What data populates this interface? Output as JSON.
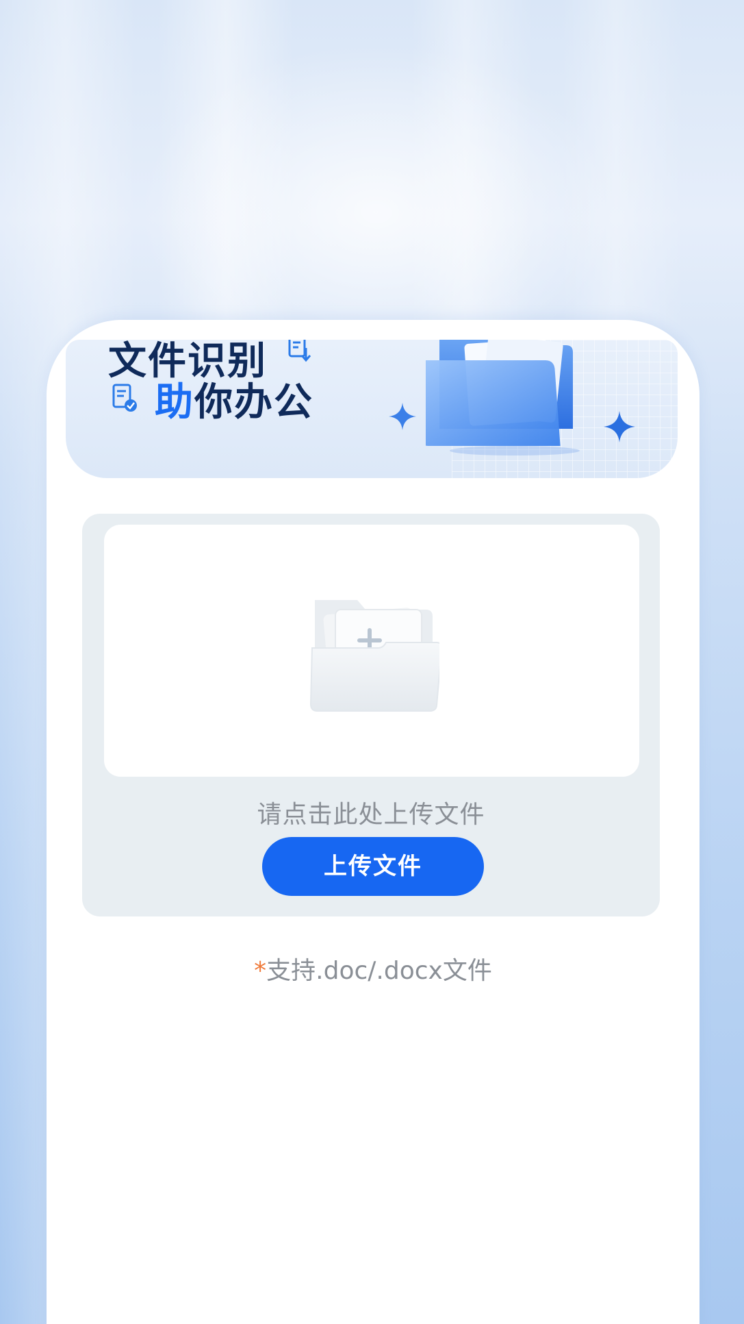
{
  "banner": {
    "title_line1": "文件识别",
    "title_line2_accent": "助",
    "title_line2_rest": "你办公",
    "decor_icons": [
      "document-download-icon",
      "document-check-icon",
      "blue-folder-illustration",
      "sparkle-icon"
    ]
  },
  "upload": {
    "dropzone_icon": "folder-plus-icon",
    "hint": "请点击此处上传文件",
    "button_label": "上传文件"
  },
  "support": {
    "asterisk": "*",
    "text": "支持.doc/.docx文件"
  },
  "colors": {
    "accent": "#1767f2",
    "title": "#0f2a5a",
    "hint_text": "#8a8f96",
    "asterisk": "#ef7a3a",
    "panel_bg": "#e8eef2"
  }
}
